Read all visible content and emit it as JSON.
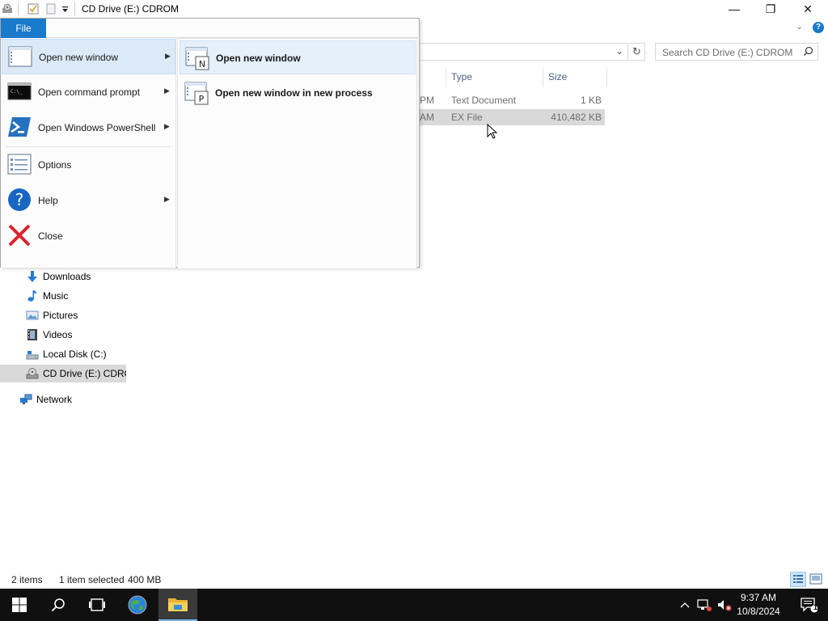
{
  "window": {
    "title": "CD Drive (E:) CDROM",
    "minimize": "—",
    "restore": "❐",
    "close": "✕"
  },
  "search": {
    "placeholder": "Search CD Drive (E:) CDROM"
  },
  "file_list": {
    "columns": [
      "Type",
      "Size"
    ],
    "rows": [
      {
        "time_fragment": "PM",
        "type": "Text Document",
        "size": "1 KB"
      },
      {
        "time_fragment": "AM",
        "type": "EX File",
        "size": "410,482 KB",
        "selected": true
      }
    ]
  },
  "nav": {
    "items": [
      {
        "label": "Downloads"
      },
      {
        "label": "Music"
      },
      {
        "label": "Pictures"
      },
      {
        "label": "Videos"
      },
      {
        "label": "Local Disk (C:)"
      },
      {
        "label": "CD Drive (E:) CDROM",
        "selected": true
      }
    ],
    "network": "Network"
  },
  "status": {
    "items_count": "2 items",
    "selection": "1 item selected",
    "size": "400 MB"
  },
  "file_menu": {
    "tab_label": "File",
    "items": [
      {
        "label": "Open new window",
        "submenu": true
      },
      {
        "label": "Open command prompt",
        "submenu": true
      },
      {
        "label": "Open Windows PowerShell",
        "submenu": true
      },
      {
        "label": "Options",
        "submenu": false
      },
      {
        "label": "Help",
        "submenu": true
      },
      {
        "label": "Close",
        "submenu": false
      }
    ],
    "submenu": [
      {
        "label": "Open new window",
        "icon_letter": "N"
      },
      {
        "label": "Open new window in new process",
        "icon_letter": "P"
      }
    ]
  },
  "taskbar": {
    "time": "9:37 AM",
    "date": "10/8/2024",
    "notification_count": "1"
  },
  "colors": {
    "accent": "#1979ca",
    "taskbar": "#101010",
    "selection": "#d9d9d9",
    "menu_hover": "#dce9f7"
  }
}
